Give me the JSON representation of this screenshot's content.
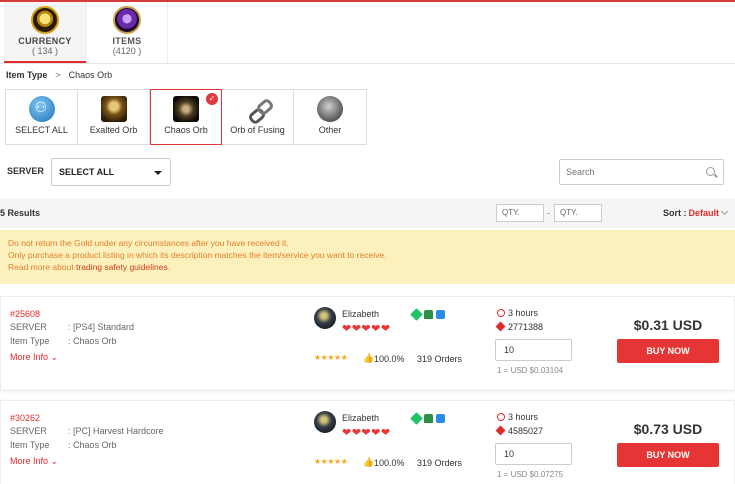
{
  "tabs": [
    {
      "label": "CURRENCY",
      "count": "( 134 )",
      "icon": "currency-orb-icon"
    },
    {
      "label": "ITEMS",
      "count": "(4120 )",
      "icon": "items-orb-icon"
    }
  ],
  "breadcrumb": {
    "label": "Item Type",
    "separator": ">",
    "current": "Chaos Orb"
  },
  "item_types": [
    {
      "label": "SELECT ALL",
      "icon": "select-all-icon"
    },
    {
      "label": "Exalted Orb",
      "icon": "exalted-orb-icon"
    },
    {
      "label": "Chaos Orb",
      "icon": "chaos-orb-icon",
      "selected": true
    },
    {
      "label": "Orb of Fusing",
      "icon": "orb-of-fusing-icon"
    },
    {
      "label": "Other",
      "icon": "other-icon"
    }
  ],
  "server": {
    "label": "SERVER",
    "selected": "SELECT ALL"
  },
  "search": {
    "placeholder": "Search"
  },
  "results": {
    "text": "5 Results",
    "qty_min_placeholder": "QTY.",
    "qty_max_placeholder": "QTY.",
    "sort_label": "Sort :",
    "sort_value": "Default"
  },
  "notice": {
    "line1": "Do not return the Gold under any circumstances after you have received it.",
    "line2": "Only purchase a product listing in which its description matches the item/service you want to receive.",
    "line3_prefix": "Read more about ",
    "line3_link": "trading safety guidelines",
    "line3_suffix": "."
  },
  "listings": [
    {
      "id": "#25608",
      "server_key": "SERVER",
      "server_val": ": [PS4] Standard",
      "type_key": "Item Type",
      "type_val": ": Chaos Orb",
      "more": "More Info",
      "seller": "Elizabeth",
      "hearts": "❤❤❤❤❤",
      "stars": "★★★★★",
      "rating": "100.0%",
      "orders": "319 Orders",
      "delivery": "3 hours",
      "stock": "2771388",
      "qty": "10",
      "unit_price": "1 = USD $0.03104",
      "price": "$0.31 USD",
      "buy": "BUY NOW"
    },
    {
      "id": "#30262",
      "server_key": "SERVER",
      "server_val": ": [PC] Harvest Hardcore",
      "type_key": "Item Type",
      "type_val": ": Chaos Orb",
      "more": "More Info",
      "seller": "Elizabeth",
      "hearts": "❤❤❤❤❤",
      "stars": "★★★★★",
      "rating": "100.0%",
      "orders": "319 Orders",
      "delivery": "3 hours",
      "stock": "4585027",
      "qty": "10",
      "unit_price": "1 = USD $0.07275",
      "price": "$0.73 USD",
      "buy": "BUY NOW"
    }
  ]
}
